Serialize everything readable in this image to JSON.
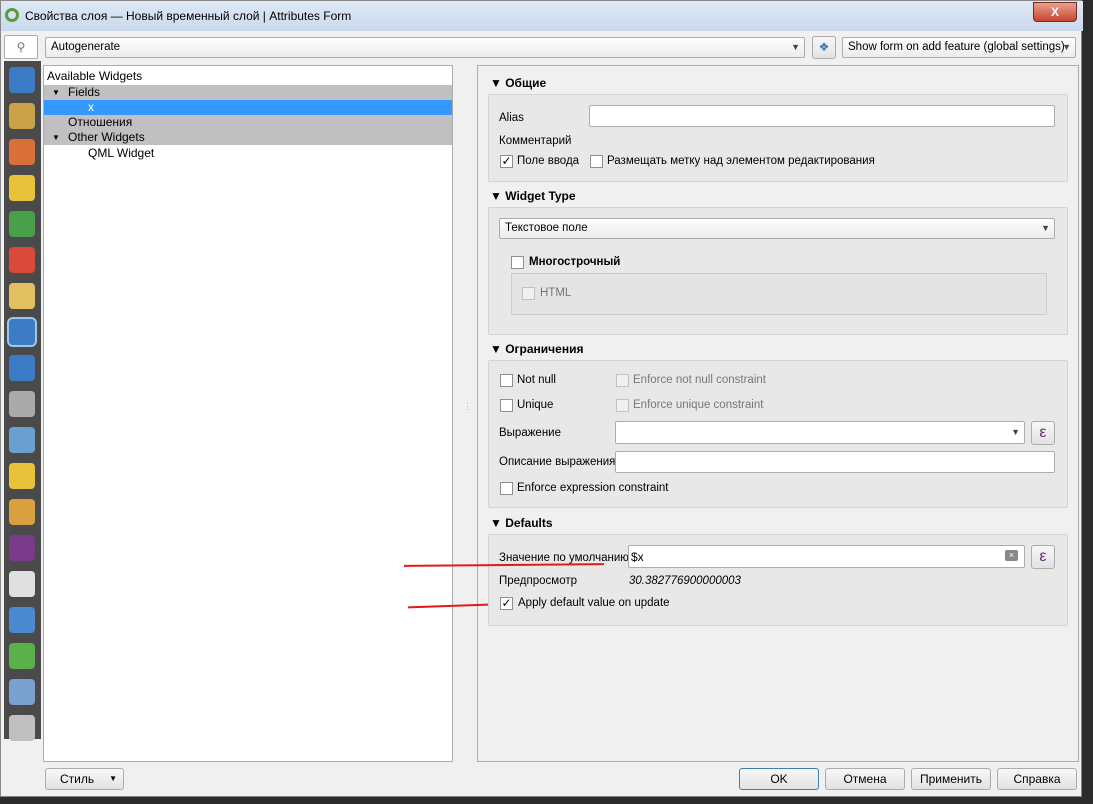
{
  "window": {
    "title": "Свойства слоя — Новый временный слой | Attributes Form",
    "close": "X"
  },
  "toolbar": {
    "layout_mode": "Autogenerate",
    "form_suppress": "Show form on add feature (global settings)"
  },
  "sidebar": {
    "items": [
      "information",
      "source",
      "symbology",
      "labels",
      "diagrams",
      "3d-view",
      "fields",
      "attributes-form",
      "joins",
      "auxiliary-storage",
      "actions",
      "display",
      "rendering",
      "variables",
      "metadata",
      "dependencies",
      "legend",
      "qgis-server",
      "digitizing"
    ]
  },
  "tree": {
    "header": "Available Widgets",
    "items": [
      {
        "label": "Fields",
        "group": true
      },
      {
        "label": "x",
        "selected": true
      },
      {
        "label": "Отношения",
        "group": true
      },
      {
        "label": "Other Widgets",
        "group": true
      },
      {
        "label": "QML Widget"
      }
    ]
  },
  "general": {
    "title": "Общие",
    "alias_label": "Alias",
    "alias_value": "",
    "comment_label": "Комментарий",
    "editable_label": "Поле ввода",
    "editable": true,
    "label_on_top_label": "Размещать метку над элементом редактирования",
    "label_on_top": false
  },
  "widget_type": {
    "title": "Widget Type",
    "value": "Текстовое поле",
    "multiline_label": "Многострочный",
    "multiline": false,
    "html_label": "HTML",
    "html": false
  },
  "constraints": {
    "title": "Ограничения",
    "not_null": "Not null",
    "enforce_not_null": "Enforce not null constraint",
    "unique": "Unique",
    "enforce_unique": "Enforce unique constraint",
    "expression_label": "Выражение",
    "expression_value": "",
    "description_label": "Описание выражения",
    "description_value": "",
    "enforce_expression": "Enforce expression constraint"
  },
  "defaults": {
    "title": "Defaults",
    "default_label": "Значение по умолчанию",
    "default_value": "$x",
    "preview_label": "Предпросмотр",
    "preview_value": "30.382776900000003",
    "apply_on_update_label": "Apply default value on update",
    "apply_on_update": true
  },
  "footer": {
    "style": "Стиль",
    "ok": "OK",
    "cancel": "Отмена",
    "apply": "Применить",
    "help": "Справка"
  },
  "colors": {
    "selection": "#3399ff",
    "group_bg": "#c0c0c0",
    "annotation_arrow": "#e21a1a"
  }
}
